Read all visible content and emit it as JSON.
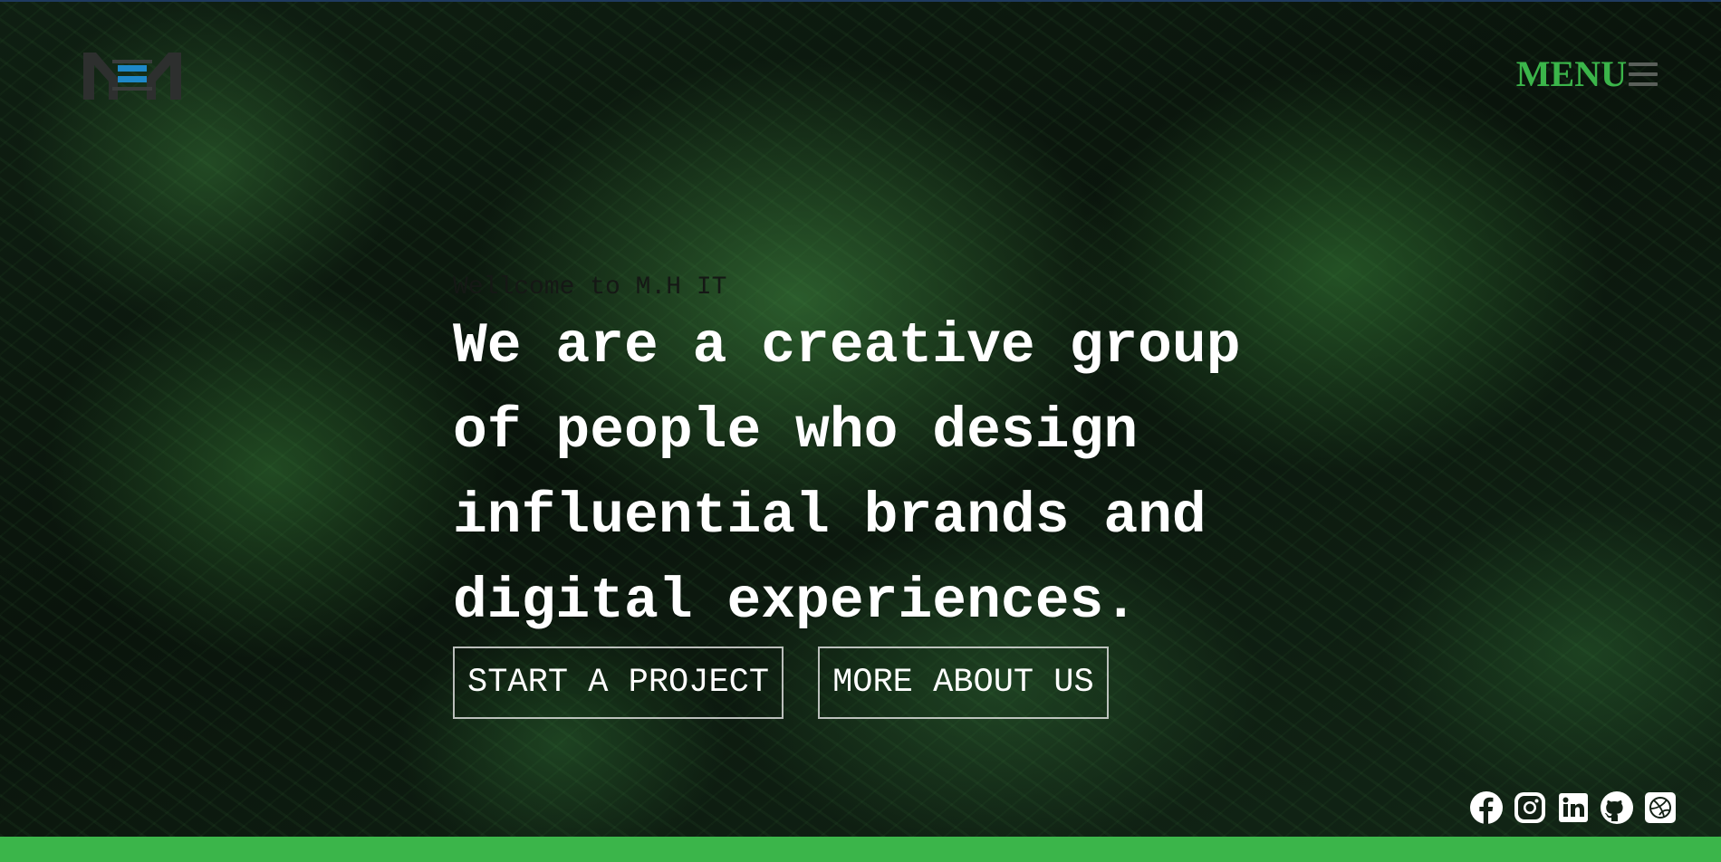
{
  "header": {
    "logo_name": "mh-logo",
    "menu_label": "MENU",
    "menu_icon": "hamburger-icon"
  },
  "hero": {
    "welcome": "Wellcome to M.H IT",
    "headline": "We are a creative group of people who design influential brands and digital experiences.",
    "buttons": {
      "start_project": "START A PROJECT",
      "more_about": "MORE ABOUT US"
    }
  },
  "social": [
    {
      "icon": "facebook-icon"
    },
    {
      "icon": "instagram-icon"
    },
    {
      "icon": "linkedin-icon"
    },
    {
      "icon": "github-icon"
    },
    {
      "icon": "dribbble-icon"
    }
  ],
  "colors": {
    "accent": "#3bb54a",
    "text": "#ffffff",
    "welcome_text": "#151815"
  }
}
